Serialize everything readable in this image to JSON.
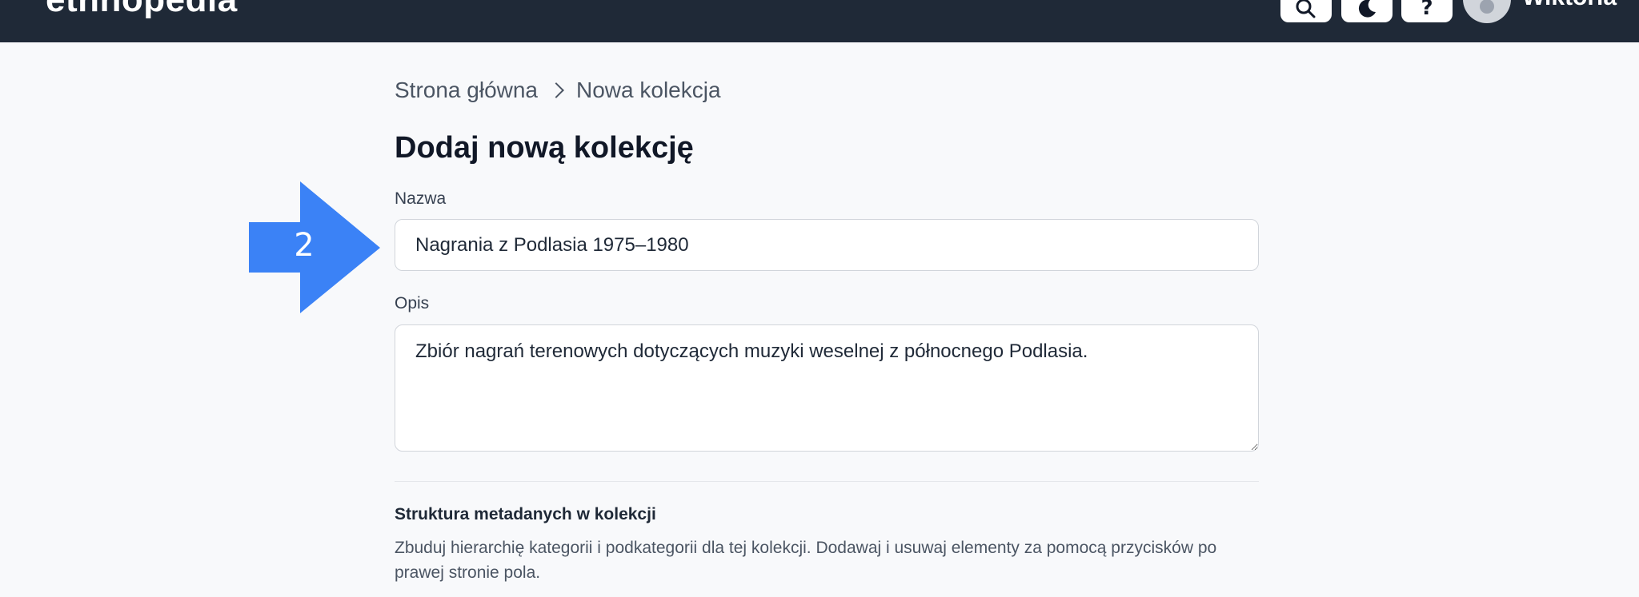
{
  "header": {
    "logo": "ethnopedia",
    "user_name": "Wiktoria",
    "buttons": [
      {
        "icon": "search-icon"
      },
      {
        "icon": "moon-icon"
      },
      {
        "icon": "help-icon",
        "glyph": "?"
      }
    ]
  },
  "breadcrumb": {
    "home": "Strona główna",
    "current": "Nowa kolekcja"
  },
  "page": {
    "title": "Dodaj nową kolekcję"
  },
  "form": {
    "name_label": "Nazwa",
    "name_value": "Nagrania z Podlasia 1975–1980",
    "description_label": "Opis",
    "description_value": "Zbiór nagrań terenowych dotyczących muzyki weselnej z północnego Podlasia."
  },
  "metadata_section": {
    "title": "Struktura metadanych w kolekcji",
    "description": "Zbuduj hierarchię kategorii i podkategorii dla tej kolekcji. Dodawaj i usuwaj elementy za pomocą przycisków po prawej stronie pola."
  },
  "annotation": {
    "step_number": "2",
    "color": "#3b82f6"
  },
  "colors": {
    "topbar": "#1f2937",
    "background": "#f8f9fb"
  }
}
